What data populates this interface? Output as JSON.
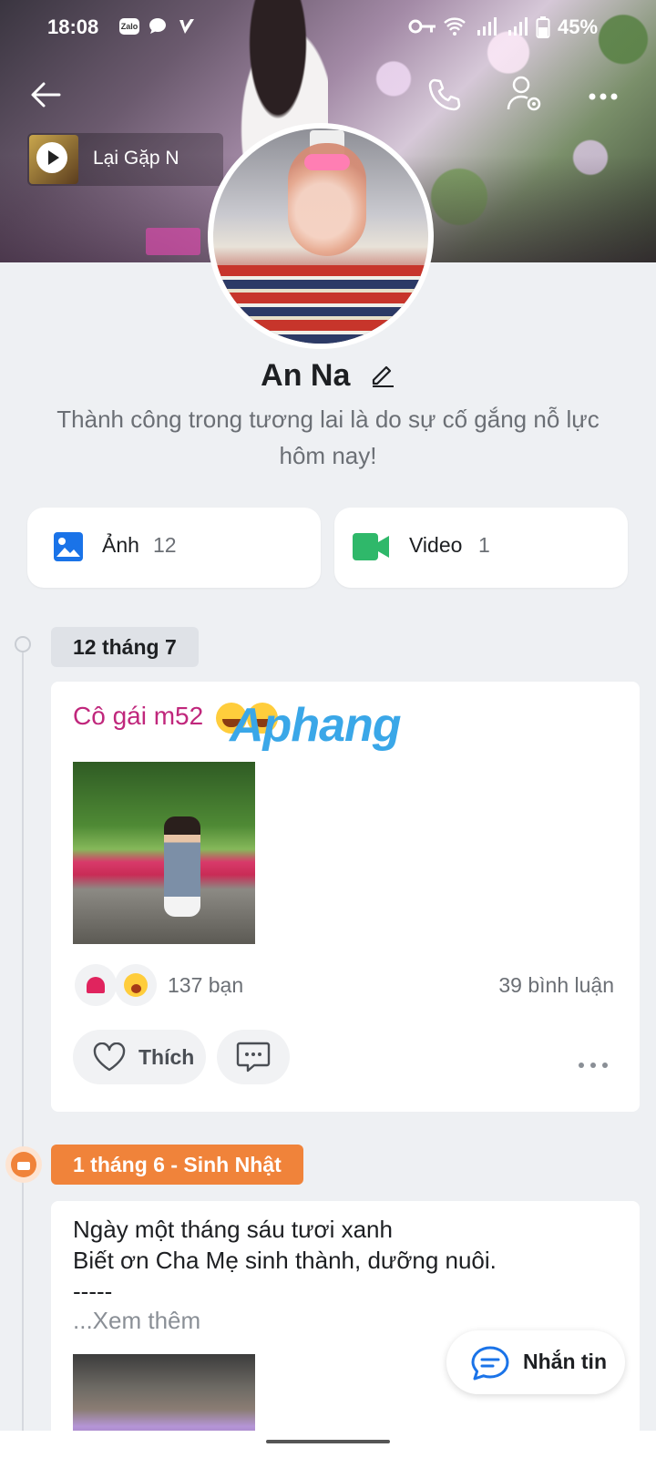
{
  "status_bar": {
    "time": "18:08",
    "app_badge": "Zalo",
    "battery": "45%"
  },
  "cover": {
    "music": {
      "title": "Lại    Gặp N"
    }
  },
  "profile": {
    "name": "An Na",
    "bio": "Thành công trong tương lai là do sự cố gắng nỗ lực hôm nay!"
  },
  "media_tiles": [
    {
      "label": "Ảnh",
      "count": "12",
      "icon": "photo-icon",
      "color": "#1a73e8"
    },
    {
      "label": "Video",
      "count": "1",
      "icon": "video-icon",
      "color": "#2fb86a"
    }
  ],
  "timeline": {
    "groups": [
      {
        "date": "12 tháng 7",
        "post": {
          "text": "Cô gái m52",
          "watermark_a": "Aphang",
          "reactions": "137 bạn",
          "comments": "39 bình luận",
          "like_label": "Thích"
        }
      },
      {
        "date": "1 tháng 6 - Sinh Nhật",
        "post": {
          "line1": "Ngày một tháng sáu tươi xanh",
          "line2": "Biết ơn Cha Mẹ sinh thành, dưỡng nuôi.",
          "line3": "-----",
          "see_more": "...Xem thêm"
        }
      }
    ]
  },
  "fab": {
    "label": "Nhắn tin"
  },
  "colors": {
    "accent_pink": "#c0277c",
    "birthday_orange": "#f0833a",
    "photo_blue": "#1a73e8",
    "video_green": "#2fb86a"
  }
}
